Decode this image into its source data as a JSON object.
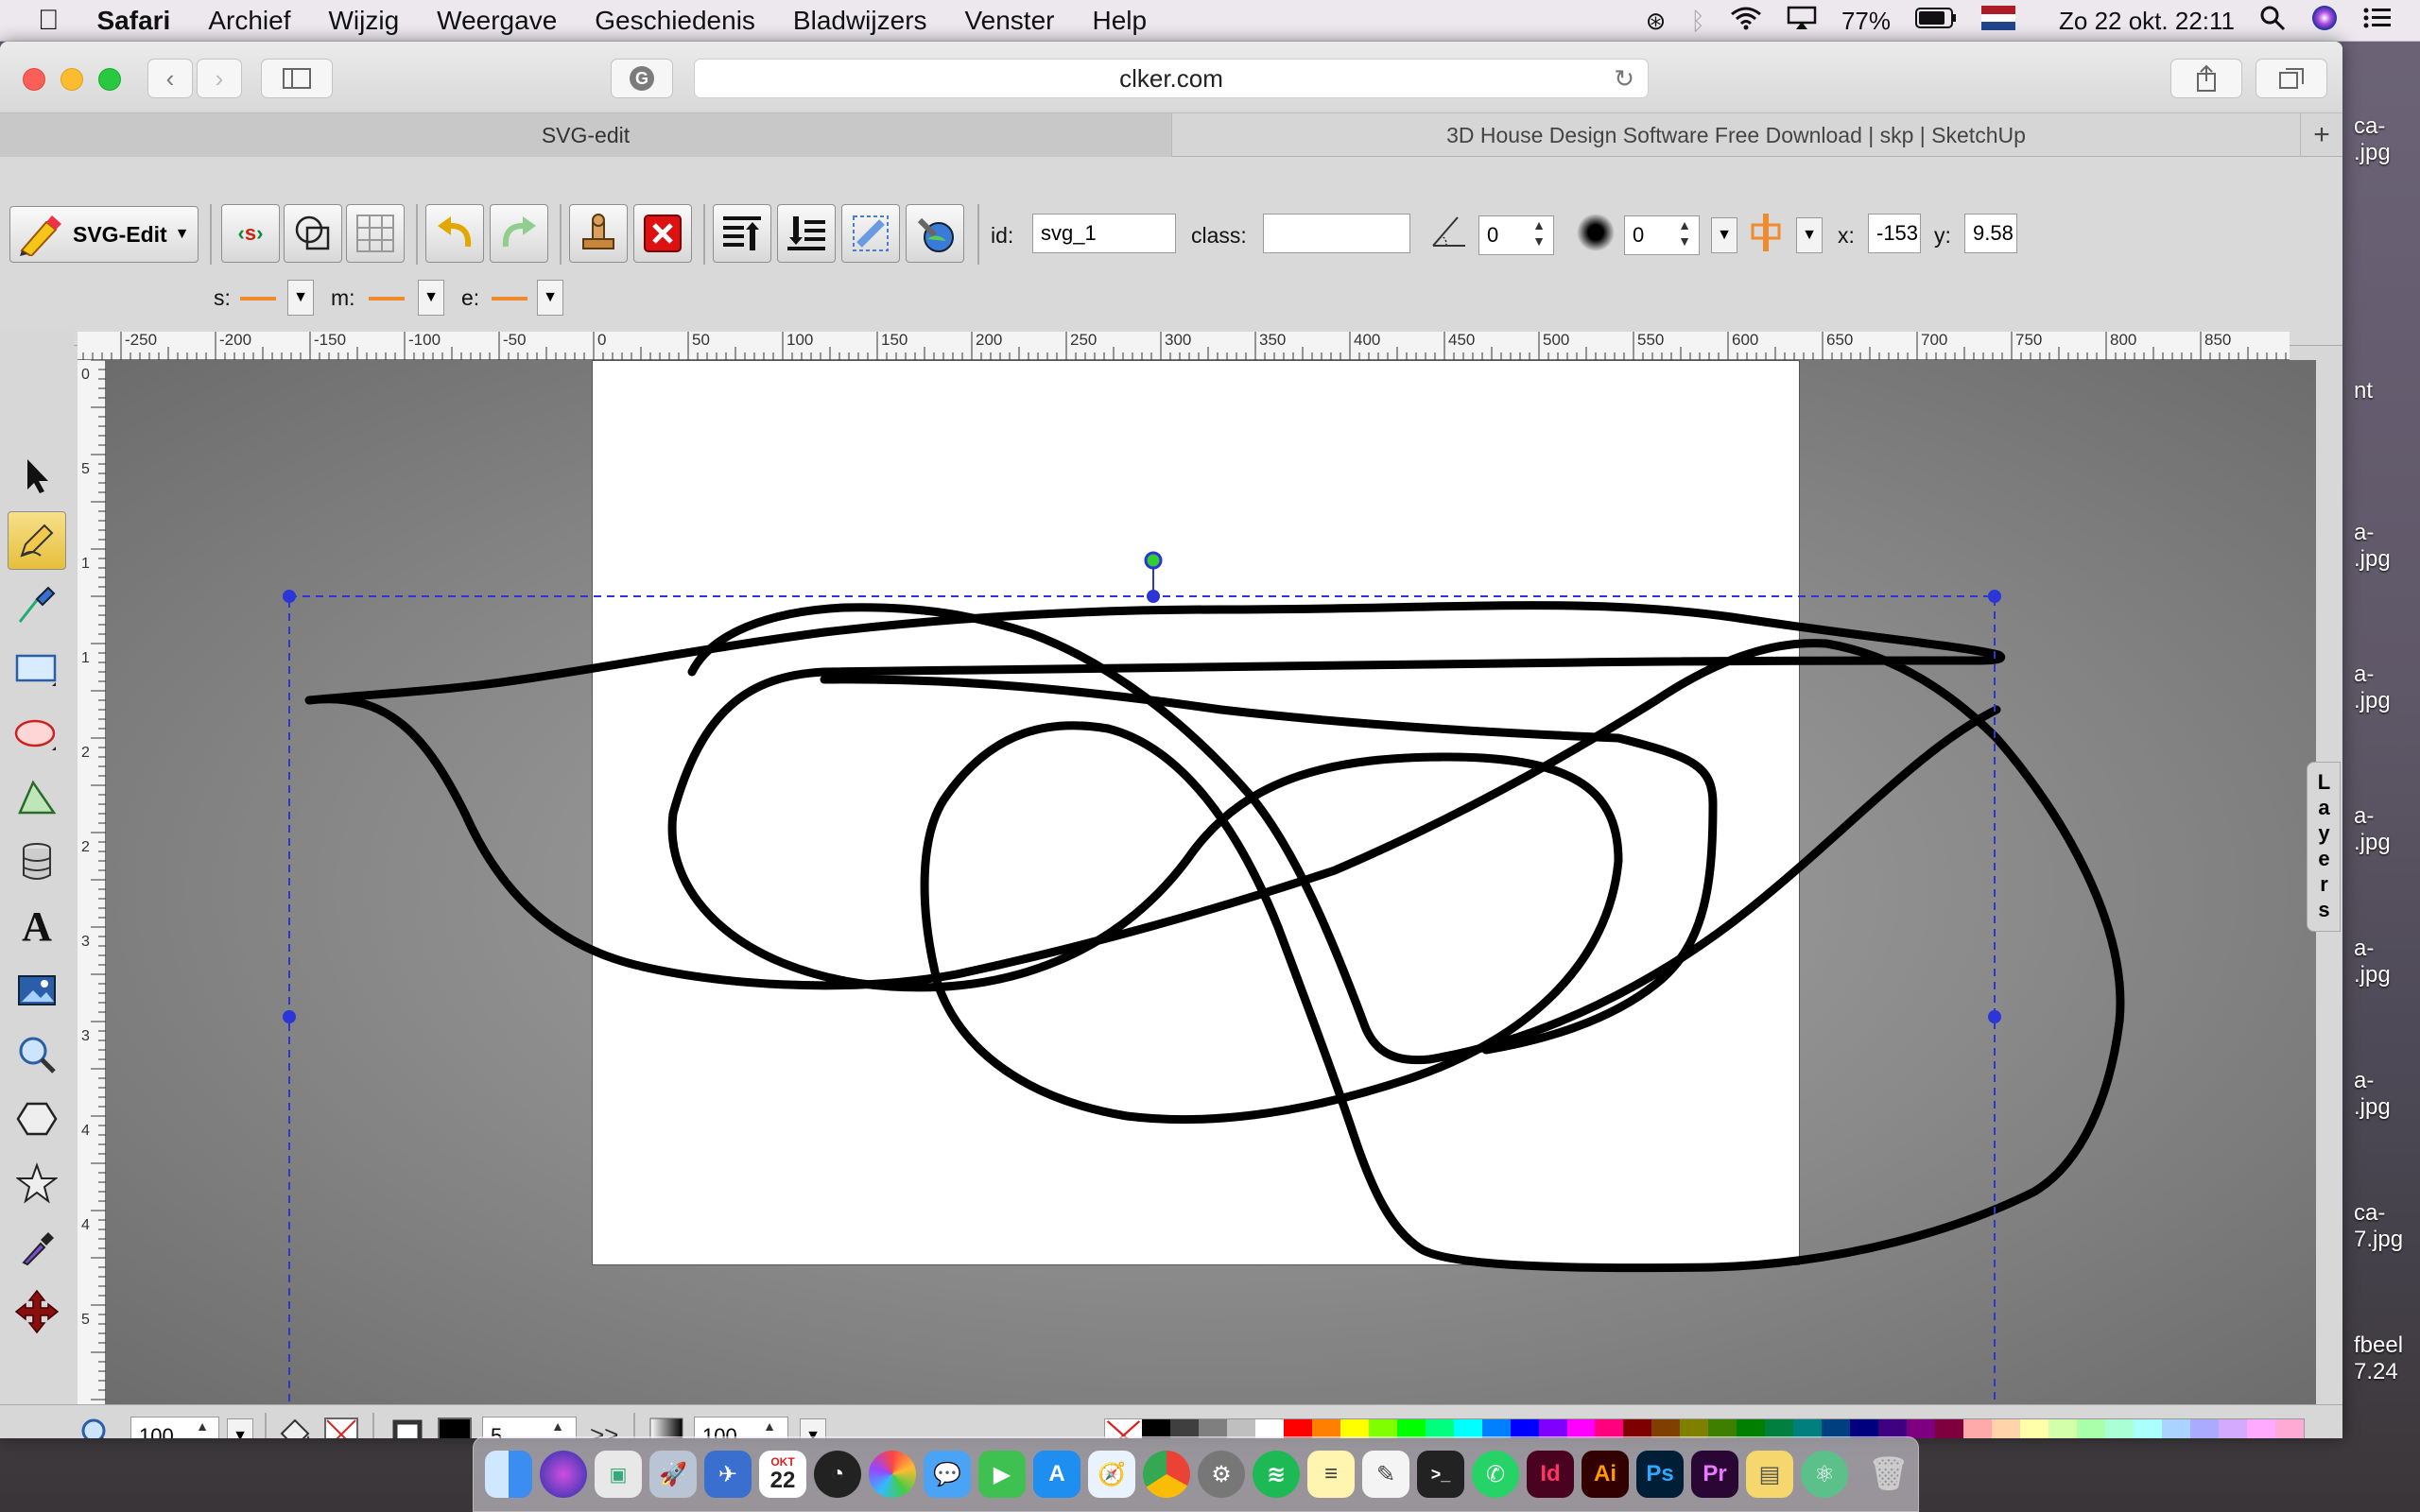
{
  "menubar": {
    "apple": "",
    "app_name": "Safari",
    "items": [
      "Archief",
      "Wijzig",
      "Weergave",
      "Geschiedenis",
      "Bladwijzers",
      "Venster",
      "Help"
    ],
    "battery": "77%",
    "clock": "Zo 22 okt.  22:11"
  },
  "browser": {
    "url": "clker.com",
    "tabs": [
      {
        "label": "SVG-edit",
        "active": true
      },
      {
        "label": "3D House Design Software Free Download | skp | SketchUp",
        "active": false
      }
    ]
  },
  "svgedit": {
    "logo_label": "SVG-Edit",
    "id_label": "id:",
    "id_value": "svg_1",
    "class_label": "class:",
    "class_value": "",
    "angle_value": "0",
    "blur_value": "0",
    "x_label": "x:",
    "x_value": "-153",
    "y_label": "y:",
    "y_value": "9.58",
    "marker_s": "s:",
    "marker_m": "m:",
    "marker_e": "e:",
    "zoom_value": "100",
    "stroke_width": "5",
    "opacity_value": "100",
    "more": ">>",
    "layers_label": "Layers",
    "ruler_top": [
      "-250",
      "-200",
      "-150",
      "-100",
      "-50",
      "0",
      "50",
      "100",
      "150",
      "200",
      "250",
      "300",
      "350",
      "400",
      "450",
      "500",
      "550",
      "600",
      "650",
      "700",
      "750",
      "800",
      "850"
    ],
    "ruler_left": [
      "0",
      "5",
      "1",
      "1",
      "2",
      "2",
      "3",
      "3",
      "4",
      "4",
      "5"
    ]
  },
  "colors": {
    "stroke": "#000000",
    "accent_orange": "#f08a2c",
    "selection": "#2b35d8",
    "palette": [
      "#000000",
      "#3f3f3f",
      "#7f7f7f",
      "#bfbfbf",
      "#ffffff",
      "#ff0000",
      "#ff7f00",
      "#ffff00",
      "#7fff00",
      "#00ff00",
      "#00ff7f",
      "#00ffff",
      "#007fff",
      "#0000ff",
      "#7f00ff",
      "#ff00ff",
      "#ff007f",
      "#7f0000",
      "#7f3f00",
      "#7f7f00",
      "#3f7f00",
      "#007f00",
      "#007f3f",
      "#007f7f",
      "#003f7f",
      "#00007f",
      "#3f007f",
      "#7f007f",
      "#7f003f",
      "#ffaaaa",
      "#ffd4aa",
      "#ffffaa",
      "#d4ffaa",
      "#aaffaa",
      "#aaffd4",
      "#aaffff",
      "#aad4ff",
      "#aaaaff",
      "#d4aaff",
      "#ffaaff",
      "#ffaad4"
    ]
  },
  "desktop_files": [
    "ca-\n.jpg",
    "nt",
    "a-\n.jpg",
    "a-\n.jpg",
    "a-\n.jpg",
    "a-\n.jpg",
    "a-\n.jpg",
    "ca-\n7.jpg",
    "fbeel\n7.24"
  ],
  "dock": {
    "calendar_month": "OKT",
    "calendar_day": "22",
    "id_label": "Id",
    "ai_label": "Ai",
    "ps_label": "Ps",
    "pr_label": "Pr"
  }
}
